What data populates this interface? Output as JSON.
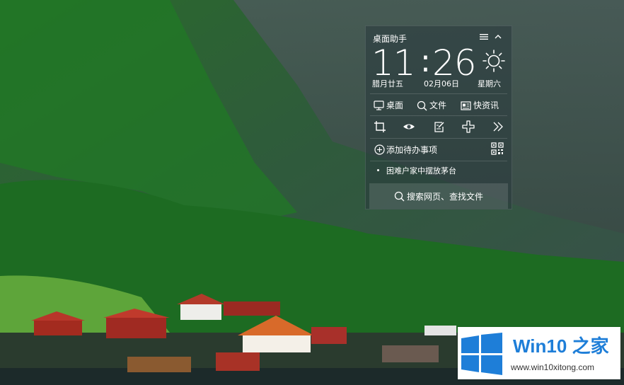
{
  "widget": {
    "title": "桌面助手",
    "menu_icon": "menu-icon",
    "collapse_icon": "chevron-up-icon",
    "clock": {
      "hour": "11",
      "colon": ":",
      "minute": "26"
    },
    "weather_icon": "sun-icon",
    "lunar_date": "腊月廿五",
    "date": "02月06日",
    "weekday": "星期六",
    "quick_links": [
      {
        "label": "桌面",
        "icon": "monitor-icon"
      },
      {
        "label": "文件",
        "icon": "search-icon"
      },
      {
        "label": "快资讯",
        "icon": "news-icon"
      }
    ],
    "tools": [
      "crop-icon",
      "eye-icon",
      "edit-icon",
      "plus-flower-icon",
      "double-chevron-right-icon"
    ],
    "todo_label": "添加待办事项",
    "qr_icon": "qr-code-icon",
    "news_item": "困难户家中摆放茅台",
    "search_label": "搜索网页、查找文件"
  },
  "watermark": {
    "brand": "Win10",
    "brand_zh": "之家",
    "url": "www.win10xitong.com",
    "logo_color": "#1e7ed8"
  }
}
